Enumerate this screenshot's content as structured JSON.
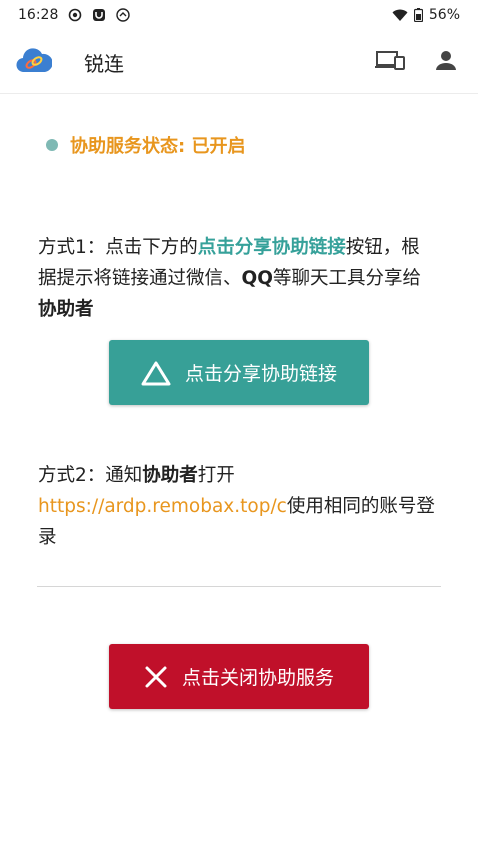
{
  "status_bar": {
    "time": "16:28",
    "battery": "56%"
  },
  "app_bar": {
    "title": "锐连",
    "icons": [
      "cloud-link-logo",
      "devices-icon",
      "person-icon"
    ]
  },
  "status": {
    "text": "协助服务状态: 已开启",
    "dot_color": "#7fb9b4",
    "text_color": "#e8961e"
  },
  "method1": {
    "prefix": "方式1：点击下方的",
    "link": "点击分享协助链接",
    "middle": "按钮，根据提示将链接通过微信、",
    "qq": "QQ",
    "tail": "等聊天工具分享给",
    "helper": "协助者"
  },
  "share_button": {
    "label": "点击分享协助链接",
    "color": "#37a097"
  },
  "method2": {
    "prefix": "方式2：通知",
    "helper": "协助者",
    "open": "打开",
    "url": "https://ardp.remobax.top/c",
    "tail": "使用相同的账号登录"
  },
  "close_button": {
    "label": "点击关闭协助服务",
    "color": "#c0102a"
  }
}
